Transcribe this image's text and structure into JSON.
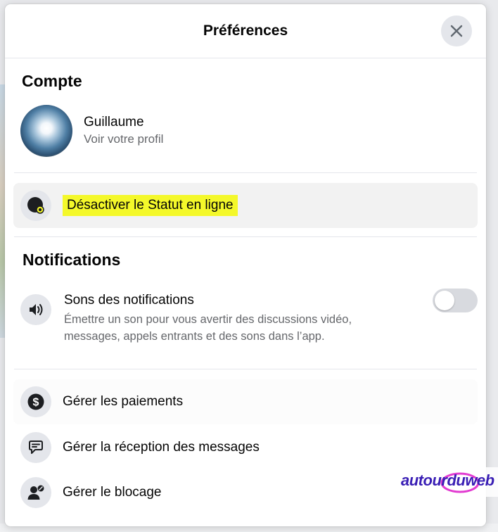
{
  "dialog": {
    "title": "Préférences",
    "close_icon": "close-icon"
  },
  "account": {
    "section_title": "Compte",
    "user_name": "Guillaume",
    "profile_link": "Voir votre profil"
  },
  "active_status": {
    "label": "Désactiver le Statut en ligne",
    "icon": "active-status-icon",
    "highlight_color": "#f4f82a"
  },
  "notifications": {
    "section_title": "Notifications",
    "sound_title": "Sons des notifications",
    "sound_desc": "Émettre un son pour vous avertir des discussions vidéo, messages, appels entrants et des sons dans l’app.",
    "sound_enabled": false
  },
  "menu": [
    {
      "label": "Gérer les paiements",
      "icon": "dollar-icon"
    },
    {
      "label": "Gérer la réception des messages",
      "icon": "message-settings-icon"
    },
    {
      "label": "Gérer le blocage",
      "icon": "block-user-icon"
    }
  ],
  "watermark": {
    "text": "autourduweb",
    "color": "#3a1fb5"
  }
}
